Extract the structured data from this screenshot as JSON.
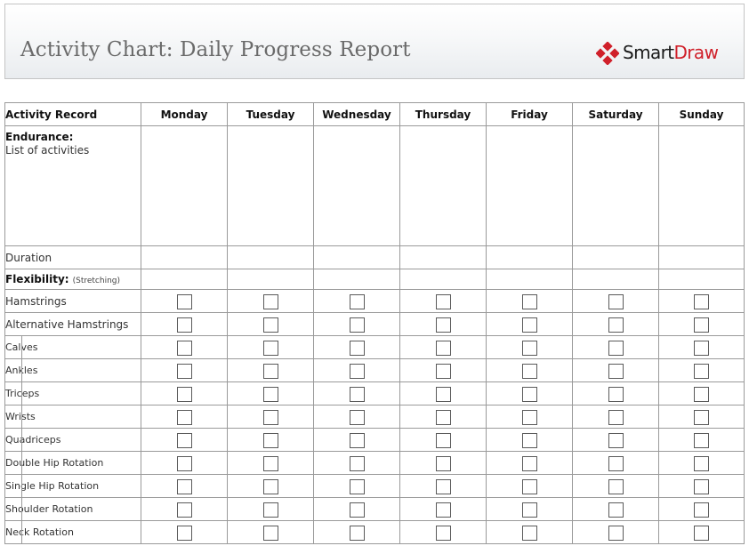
{
  "header": {
    "title": "Activity Chart: Daily Progress Report",
    "logo_part1": "Smart",
    "logo_part2": "Draw",
    "logo_color": "#d0202a"
  },
  "table": {
    "first_header": "Activity Record",
    "days": [
      "Monday",
      "Tuesday",
      "Wednesday",
      "Thursday",
      "Friday",
      "Saturday",
      "Sunday"
    ],
    "endurance": {
      "heading": "Endurance:",
      "subtitle": "List of activities"
    },
    "duration_label": "Duration",
    "flexibility": {
      "heading": "Flexibility:",
      "note": "(Stretching)"
    },
    "main_items": [
      "Hamstrings",
      "Alternative Hamstrings"
    ],
    "sub_items": [
      "Calves",
      "Ankles",
      "Triceps",
      "Wrists",
      "Quadriceps",
      "Double Hip Rotation",
      "Single Hip Rotation",
      "Shoulder Rotation",
      "Neck Rotation"
    ]
  },
  "colors": {
    "grid_border": "#9a9a9a",
    "title_text": "#6a6a6a"
  }
}
